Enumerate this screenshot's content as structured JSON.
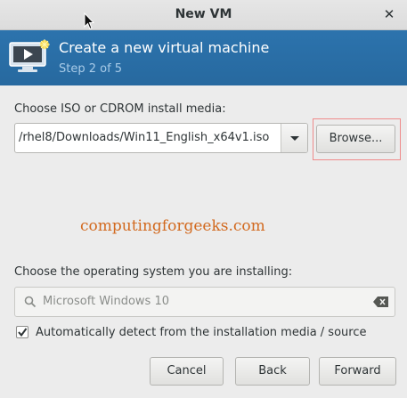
{
  "window": {
    "title": "New VM"
  },
  "banner": {
    "title": "Create a new virtual machine",
    "step": "Step 2 of 5"
  },
  "media": {
    "label": "Choose ISO or CDROM install media:",
    "path": "/rhel8/Downloads/Win11_English_x64v1.iso",
    "browse_label": "Browse..."
  },
  "watermark": "computingforgeeks.com",
  "os": {
    "label": "Choose the operating system you are installing:",
    "search_value": "Microsoft Windows 10",
    "auto_detect_label": "Automatically detect from the installation media / source",
    "auto_detect_checked": true
  },
  "buttons": {
    "cancel": "Cancel",
    "back": "Back",
    "forward": "Forward"
  },
  "colors": {
    "banner": "#2a6fa8",
    "watermark": "#d2691e",
    "highlight": "#ef8b8b"
  }
}
